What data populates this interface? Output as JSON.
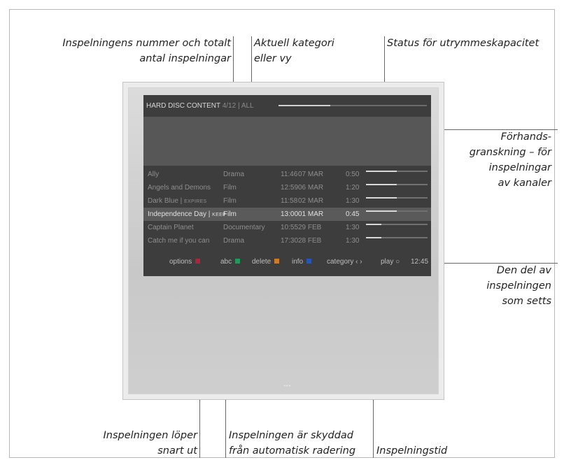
{
  "annotations": {
    "recording_count": [
      "Inspelningens nummer och totalt",
      "antal inspelningar"
    ],
    "category": [
      "Aktuell kategori",
      "eller vy"
    ],
    "storage_status": [
      "Status för utrymmeskapacitet"
    ],
    "preview": [
      "Förhands-",
      "granskning – för",
      "inspelningar",
      "av kanaler"
    ],
    "watched": [
      "Den del av",
      "inspelningen",
      "som setts"
    ],
    "expires": [
      "Inspelningen löper",
      "snart ut"
    ],
    "protected": [
      "Inspelningen är skyddad",
      "från automatisk radering"
    ],
    "duration": [
      "Inspelningstid"
    ]
  },
  "screen": {
    "title": "HARD DISC CONTENT",
    "count": "4/12",
    "separator": "|",
    "category": "ALL",
    "capacity_used_fraction": 0.35,
    "recordings": [
      {
        "title": "Ally",
        "tag": "",
        "genre": "Drama",
        "time": "11:46",
        "date": "07 MAR",
        "duration": "0:50",
        "watched": 0.5,
        "selected": false
      },
      {
        "title": "Angels and Demons",
        "tag": "",
        "genre": "Film",
        "time": "12:59",
        "date": "06 MAR",
        "duration": "1:20",
        "watched": 0.5,
        "selected": false
      },
      {
        "title": "Dark Blue |",
        "tag": "EXPIRES",
        "genre": "Film",
        "time": "11:58",
        "date": "02 MAR",
        "duration": "1:30",
        "watched": 0.5,
        "selected": false
      },
      {
        "title": "Independence Day |",
        "tag": "KEEP",
        "genre": "Film",
        "time": "13:00",
        "date": "01 MAR",
        "duration": "0:45",
        "watched": 0.5,
        "selected": true
      },
      {
        "title": "Captain Planet",
        "tag": "",
        "genre": "Documentary",
        "time": "10:55",
        "date": "29 FEB",
        "duration": "1:30",
        "watched": 0.25,
        "selected": false
      },
      {
        "title": "Catch me if you can",
        "tag": "",
        "genre": "Drama",
        "time": "17:30",
        "date": "28 FEB",
        "duration": "1:30",
        "watched": 0.25,
        "selected": false
      }
    ],
    "footer": {
      "options": "options",
      "abc": "abc",
      "delete": "delete",
      "info": "info",
      "category": "category ‹ ›",
      "play": "play ○",
      "clock": "12:45",
      "colors": {
        "red": "#b0243a",
        "green": "#1f9a5a",
        "yellow": "#d07a26",
        "blue": "#2458b8"
      }
    }
  }
}
